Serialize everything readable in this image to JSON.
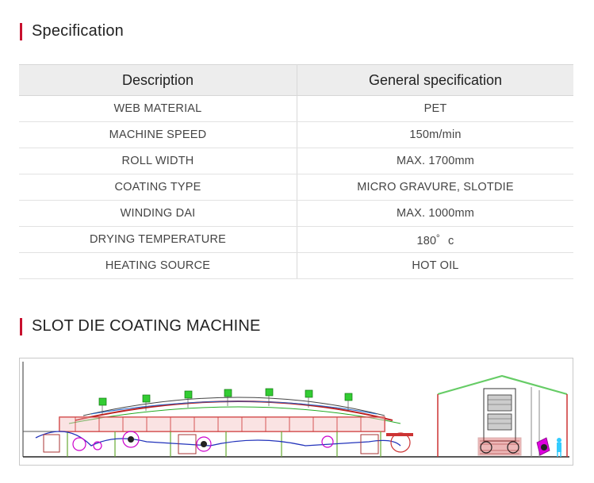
{
  "specification": {
    "title": "Specification",
    "headers": [
      "Description",
      "General specification"
    ],
    "rows": [
      [
        "WEB MATERIAL",
        "PET"
      ],
      [
        "MACHINE SPEED",
        "150m/min"
      ],
      [
        "ROLL WIDTH",
        "MAX. 1700mm"
      ],
      [
        "COATING TYPE",
        "MICRO GRAVURE, SLOTDIE"
      ],
      [
        "WINDING DAI",
        "MAX. 1000mm"
      ],
      [
        "DRYING TEMPERATURE",
        "180゜c"
      ],
      [
        "HEATING SOURCE",
        "HOT OIL"
      ]
    ]
  },
  "machine": {
    "title": "SLOT DIE COATING MACHINE"
  },
  "colors": {
    "accent": "#c8102e",
    "header_bg": "#ededed"
  }
}
